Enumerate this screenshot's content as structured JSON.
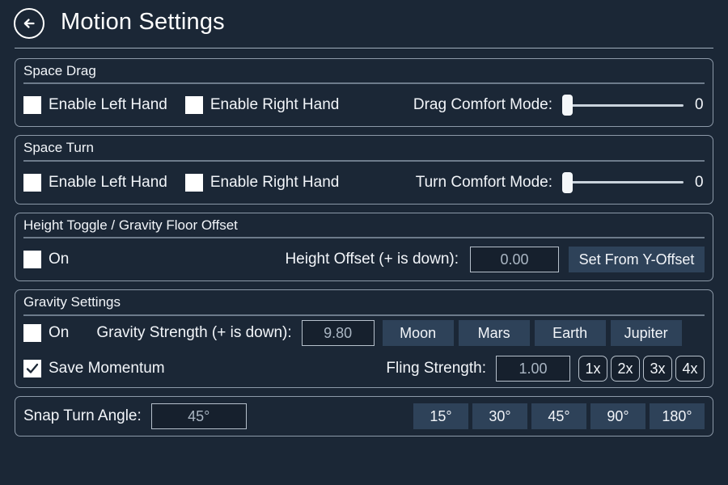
{
  "header": {
    "back_icon": "arrow-left-circle-icon",
    "title": "Motion Settings"
  },
  "sections": {
    "space_drag": {
      "title": "Space Drag",
      "left_hand": {
        "label": "Enable Left Hand",
        "checked": false
      },
      "right_hand": {
        "label": "Enable Right Hand",
        "checked": false
      },
      "comfort": {
        "label": "Drag Comfort Mode:",
        "value": "0",
        "percent": 0
      }
    },
    "space_turn": {
      "title": "Space Turn",
      "left_hand": {
        "label": "Enable Left Hand",
        "checked": false
      },
      "right_hand": {
        "label": "Enable Right Hand",
        "checked": false
      },
      "comfort": {
        "label": "Turn Comfort Mode:",
        "value": "0",
        "percent": 0
      }
    },
    "height_toggle": {
      "title": "Height Toggle / Gravity Floor Offset",
      "on": {
        "label": "On",
        "checked": false
      },
      "offset_label": "Height Offset (+ is down):",
      "offset_value": "0.00",
      "set_button": "Set From Y-Offset"
    },
    "gravity": {
      "title": "Gravity Settings",
      "on": {
        "label": "On",
        "checked": false
      },
      "save_momentum": {
        "label": "Save Momentum",
        "checked": true
      },
      "strength_label": "Gravity Strength (+ is down):",
      "strength_value": "9.80",
      "presets": [
        "Moon",
        "Mars",
        "Earth",
        "Jupiter"
      ],
      "fling_label": "Fling Strength:",
      "fling_value": "1.00",
      "fling_presets": [
        "1x",
        "2x",
        "3x",
        "4x"
      ]
    },
    "snap_turn": {
      "label": "Snap Turn Angle:",
      "value": "45°",
      "presets": [
        "15°",
        "30°",
        "45°",
        "90°",
        "180°"
      ]
    }
  },
  "colors": {
    "background": "#1b2736",
    "button": "#2e4259",
    "border": "#8c99a8",
    "text": "#f2f5f9",
    "field_text": "#aab6c3"
  }
}
